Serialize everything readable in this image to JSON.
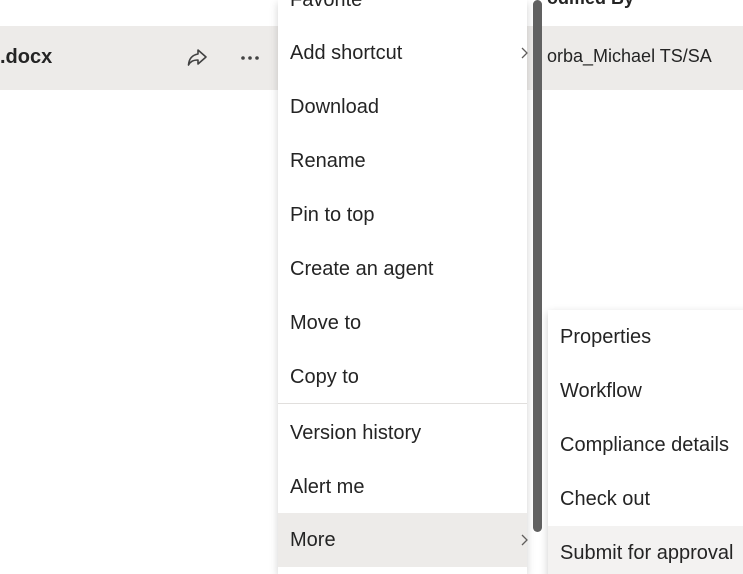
{
  "list": {
    "column_header_partial": "odified By",
    "row": {
      "file_name": ".docx",
      "modified_by": "orba_Michael TS/SA",
      "share_icon": "share-icon",
      "more_icon": "ellipsis-icon"
    }
  },
  "context_menu": {
    "items": [
      {
        "label": "Favorite"
      },
      {
        "label": "Add shortcut",
        "has_submenu": true
      },
      {
        "label": "Download"
      },
      {
        "label": "Rename"
      },
      {
        "label": "Pin to top"
      },
      {
        "label": "Create an agent"
      },
      {
        "label": "Move to"
      },
      {
        "label": "Copy to"
      },
      {
        "label": "Version history"
      },
      {
        "label": "Alert me"
      },
      {
        "label": "More",
        "has_submenu": true,
        "selected": true
      }
    ]
  },
  "submenu": {
    "items": [
      {
        "label": "Properties"
      },
      {
        "label": "Workflow"
      },
      {
        "label": "Compliance details"
      },
      {
        "label": "Check out"
      },
      {
        "label": "Submit for approval"
      }
    ]
  },
  "colors": {
    "row_highlight": "#edebe9",
    "text": "#242424",
    "scrollbar": "#616161",
    "divider": "#e1dfdd"
  }
}
